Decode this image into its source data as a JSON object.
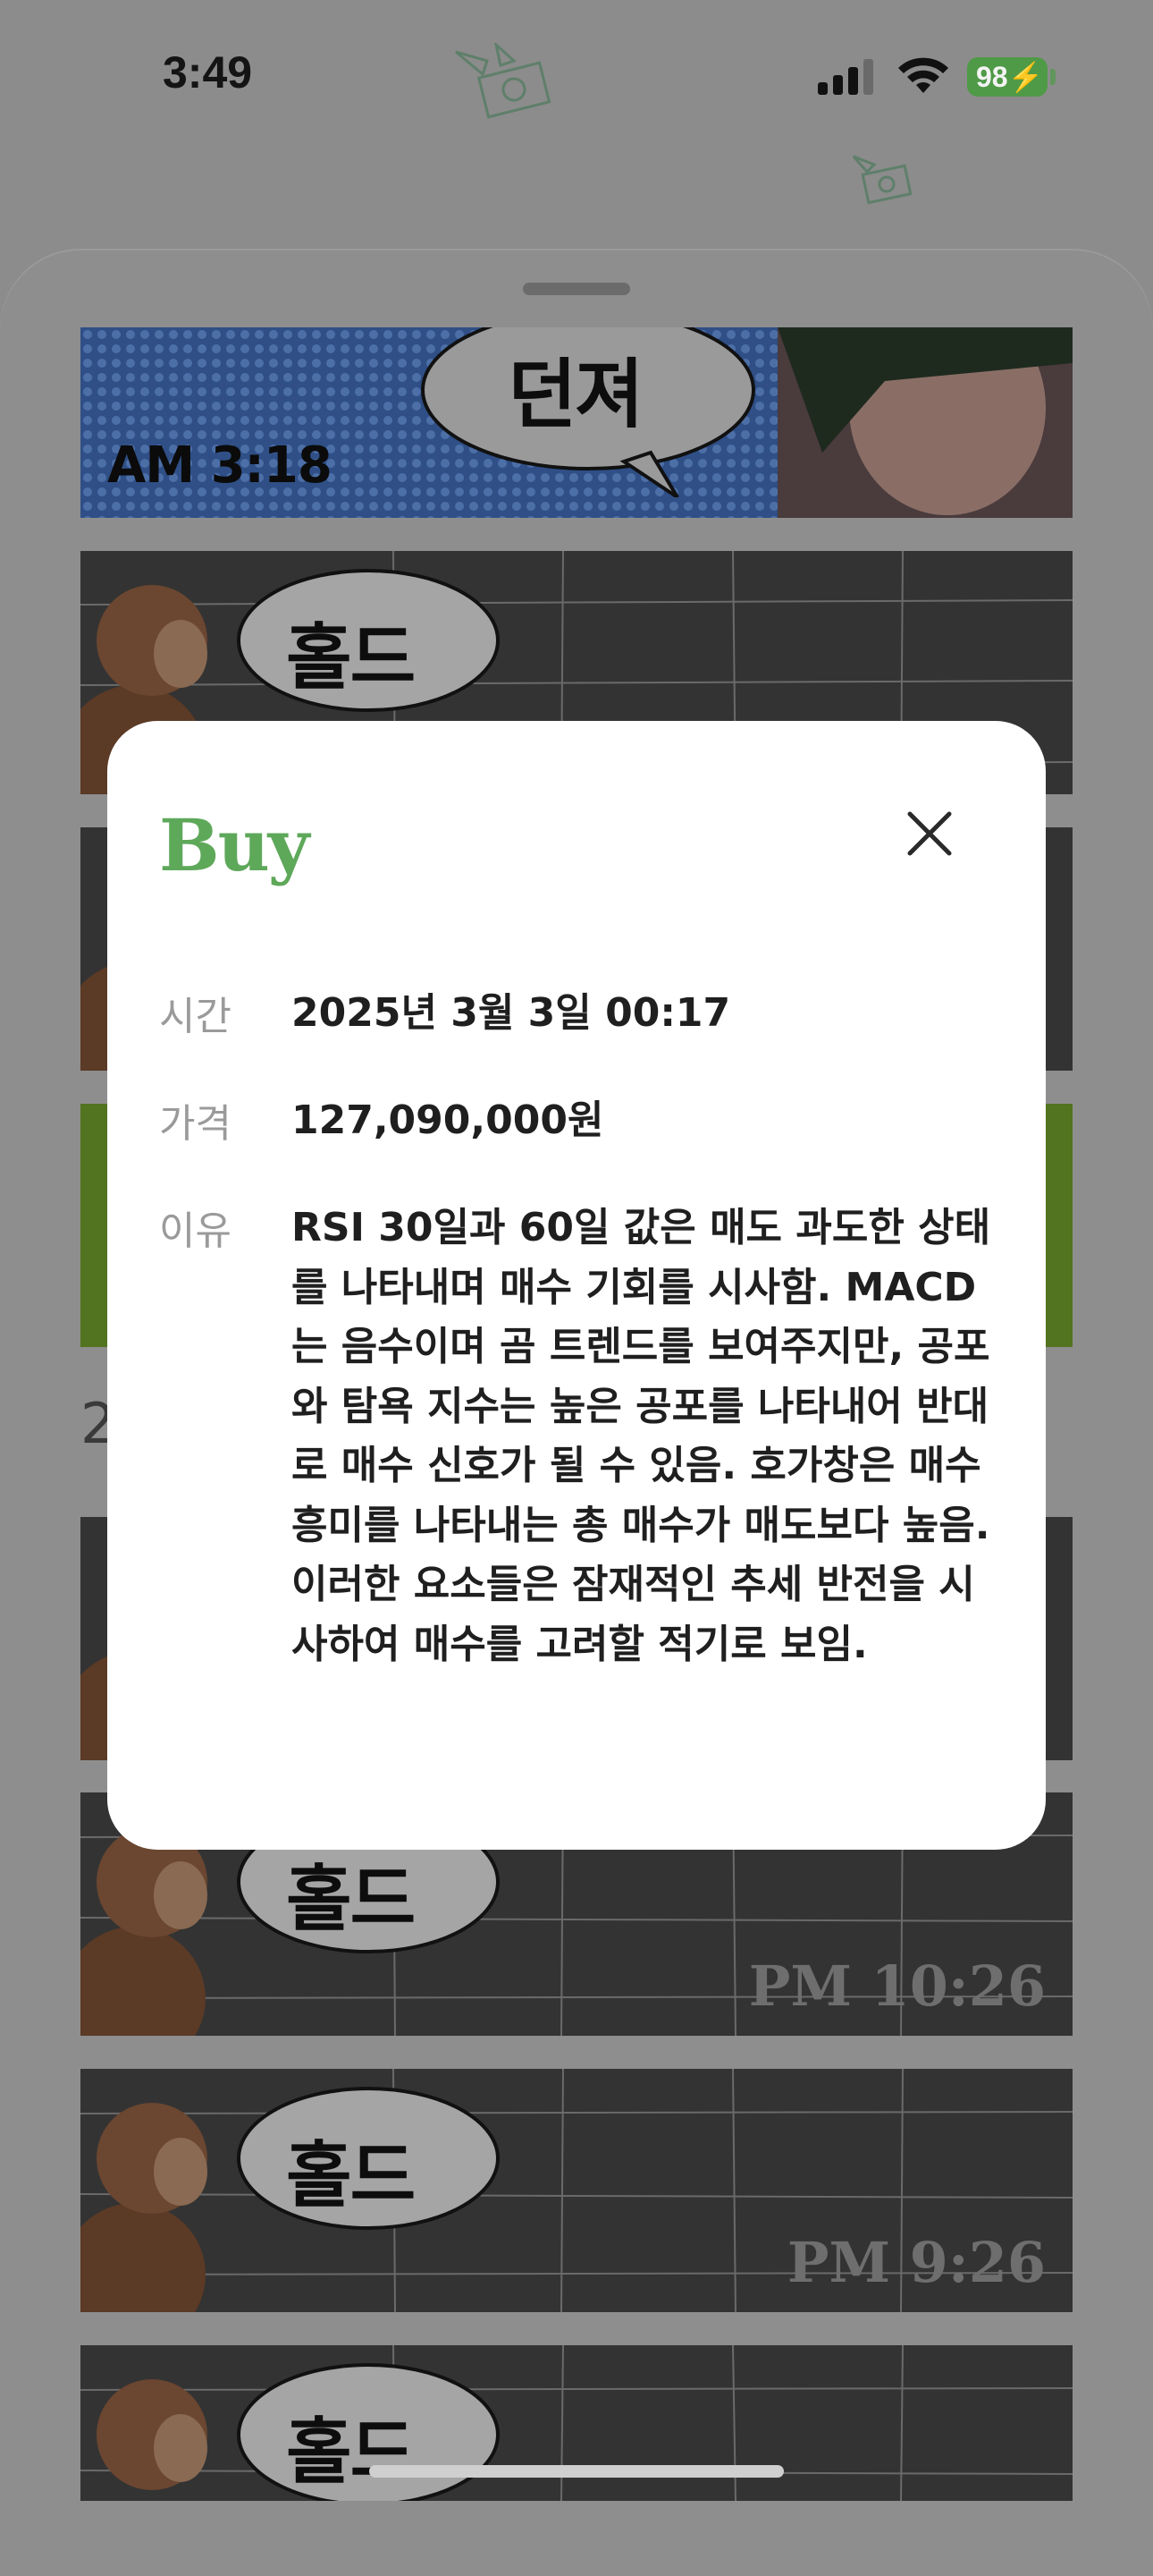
{
  "status_bar": {
    "time": "3:49",
    "battery": "98"
  },
  "feed": {
    "top_card": {
      "bubble": "던져",
      "time": "AM 3:18"
    },
    "cards": [
      {
        "bubble": "홀드",
        "time": "PM 10:26"
      },
      {
        "bubble": "홀드",
        "time": "PM 9:26"
      },
      {
        "bubble": "홀드",
        "time": ""
      }
    ]
  },
  "modal": {
    "title": "Buy",
    "fields": [
      {
        "label": "시간",
        "value": "2025년 3월 3일 00:17"
      },
      {
        "label": "가격",
        "value": "127,090,000원"
      },
      {
        "label": "이유",
        "value": "RSI 30일과 60일 값은 매도 과도한 상태를 나타내며 매수 기회를 시사함. MACD는 음수이며 곰 트렌드를 보여주지만, 공포와 탐욕 지수는 높은 공포를 나타내어 반대로 매수 신호가 될 수 있음. 호가창은 매수 흥미를 나타내는 총 매수가 매도보다 높음. 이러한 요소들은 잠재적인 추세 반전을 시사하여 매수를 고려할 적기로 보임."
      }
    ]
  },
  "colors": {
    "buy_accent": "#5ea85a",
    "battery": "#4f9a47"
  },
  "icons": [
    "signal-icon",
    "wifi-icon",
    "close-icon",
    "flying-money-icon"
  ]
}
